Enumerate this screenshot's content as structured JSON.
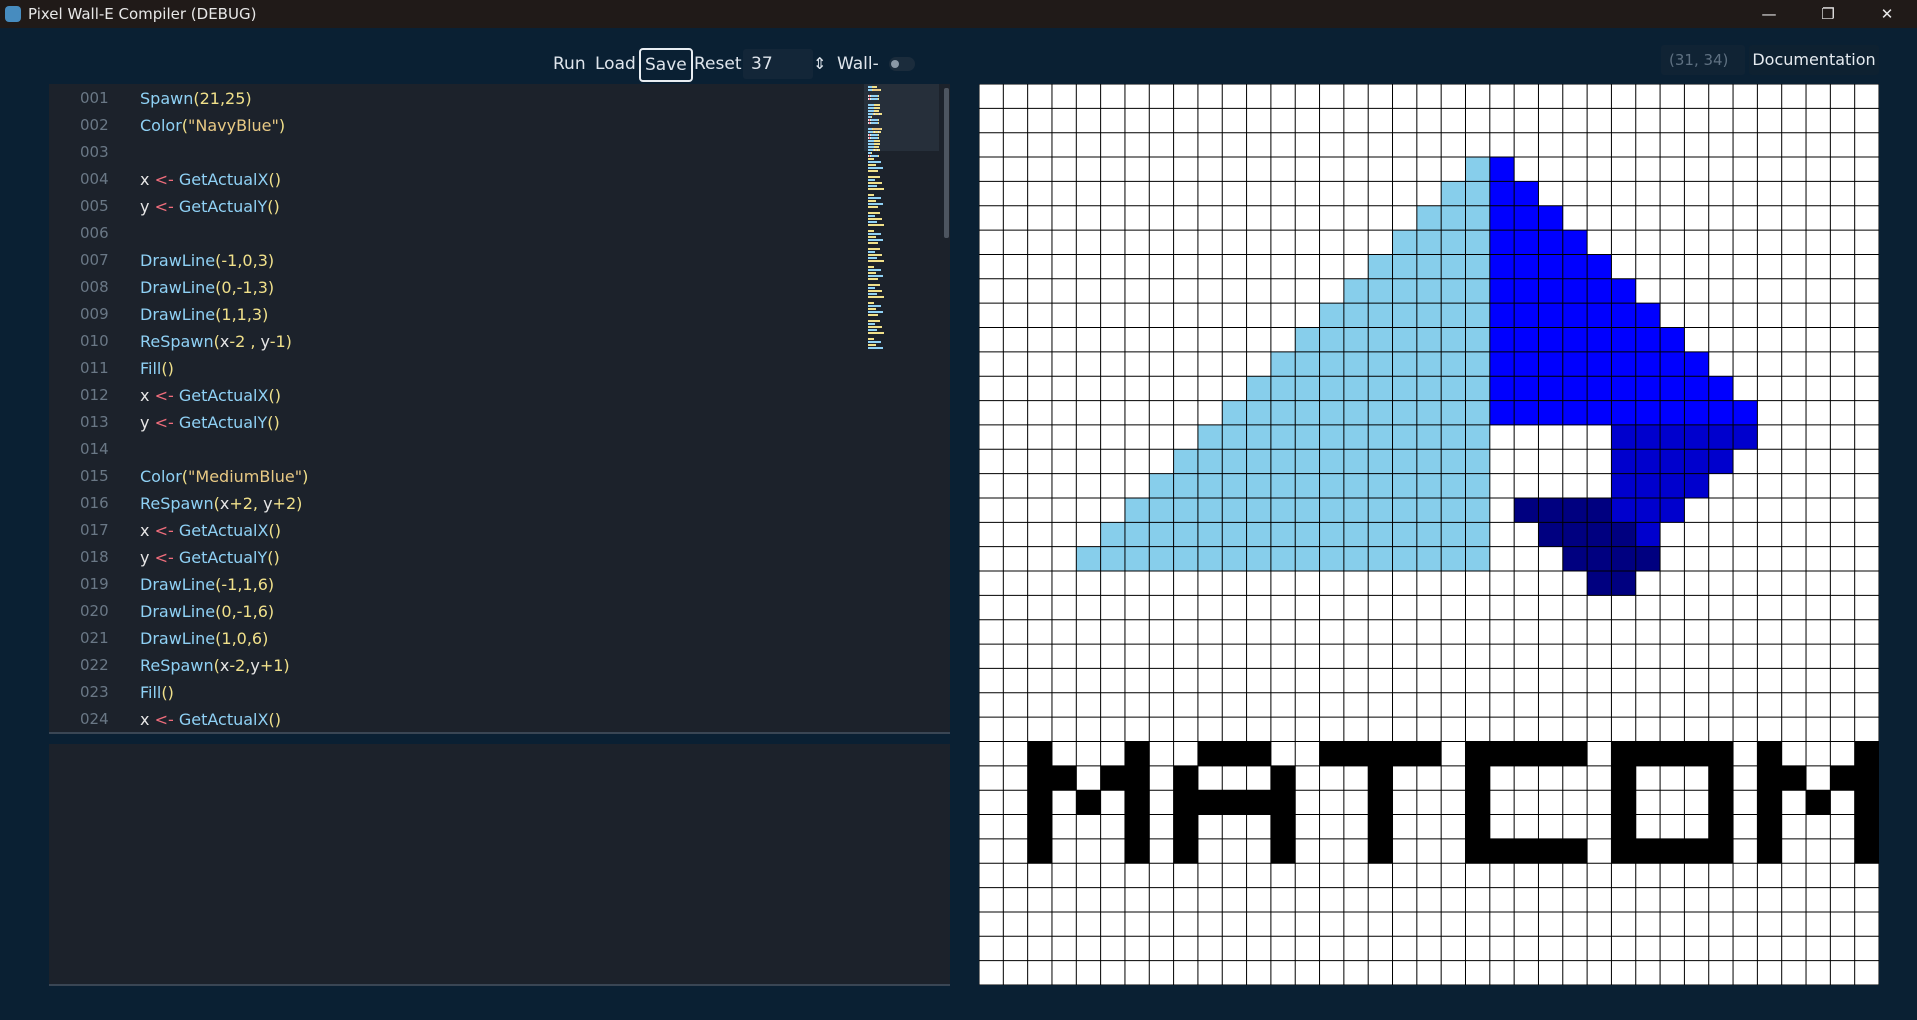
{
  "window": {
    "title": "Pixel Wall-E Compiler (DEBUG)",
    "minimize_glyph": "—",
    "restore_glyph": "❐",
    "close_glyph": "✕"
  },
  "toolbar": {
    "run_label": "Run",
    "load_label": "Load",
    "save_label": "Save",
    "reset_label": "Reset",
    "spin_value": "37",
    "spin_arrows": "⇕",
    "walle_label": "Wall-E",
    "walle_toggle_on": false
  },
  "coordinates_readout": "(31, 34)",
  "documentation_label": "Documentation",
  "editor": {
    "lines": [
      {
        "num": "001",
        "tokens": [
          [
            "f",
            "Spawn"
          ],
          [
            "p",
            "(21,25)"
          ]
        ]
      },
      {
        "num": "002",
        "tokens": [
          [
            "f",
            "Color"
          ],
          [
            "p",
            "("
          ],
          [
            "s",
            "\"NavyBlue\""
          ],
          [
            "p",
            ")"
          ]
        ]
      },
      {
        "num": "003",
        "tokens": []
      },
      {
        "num": "004",
        "tokens": [
          [
            "v",
            "x "
          ],
          [
            "o",
            "<-"
          ],
          [
            "v",
            " "
          ],
          [
            "f",
            "GetActualX"
          ],
          [
            "p",
            "()"
          ]
        ]
      },
      {
        "num": "005",
        "tokens": [
          [
            "v",
            "y "
          ],
          [
            "o",
            "<-"
          ],
          [
            "v",
            " "
          ],
          [
            "f",
            "GetActualY"
          ],
          [
            "p",
            "()"
          ]
        ]
      },
      {
        "num": "006",
        "tokens": []
      },
      {
        "num": "007",
        "tokens": [
          [
            "f",
            "DrawLine"
          ],
          [
            "p",
            "(-1,0,3)"
          ]
        ]
      },
      {
        "num": "008",
        "tokens": [
          [
            "f",
            "DrawLine"
          ],
          [
            "p",
            "(0,-1,3)"
          ]
        ]
      },
      {
        "num": "009",
        "tokens": [
          [
            "f",
            "DrawLine"
          ],
          [
            "p",
            "(1,1,3)"
          ]
        ]
      },
      {
        "num": "010",
        "tokens": [
          [
            "f",
            "ReSpawn"
          ],
          [
            "p",
            "("
          ],
          [
            "v",
            "x"
          ],
          [
            "p",
            "-2 , "
          ],
          [
            "v",
            "y"
          ],
          [
            "p",
            "-1)"
          ]
        ]
      },
      {
        "num": "011",
        "tokens": [
          [
            "f",
            "Fill"
          ],
          [
            "p",
            "()"
          ]
        ]
      },
      {
        "num": "012",
        "tokens": [
          [
            "v",
            "x "
          ],
          [
            "o",
            "<-"
          ],
          [
            "v",
            " "
          ],
          [
            "f",
            "GetActualX"
          ],
          [
            "p",
            "()"
          ]
        ]
      },
      {
        "num": "013",
        "tokens": [
          [
            "v",
            "y "
          ],
          [
            "o",
            "<-"
          ],
          [
            "v",
            " "
          ],
          [
            "f",
            "GetActualY"
          ],
          [
            "p",
            "()"
          ]
        ]
      },
      {
        "num": "014",
        "tokens": []
      },
      {
        "num": "015",
        "tokens": [
          [
            "f",
            "Color"
          ],
          [
            "p",
            "("
          ],
          [
            "s",
            "\"MediumBlue\""
          ],
          [
            "p",
            ")"
          ]
        ]
      },
      {
        "num": "016",
        "tokens": [
          [
            "f",
            "ReSpawn"
          ],
          [
            "p",
            "("
          ],
          [
            "v",
            "x"
          ],
          [
            "p",
            "+2, "
          ],
          [
            "v",
            "y"
          ],
          [
            "p",
            "+2)"
          ]
        ]
      },
      {
        "num": "017",
        "tokens": [
          [
            "v",
            "x "
          ],
          [
            "o",
            "<-"
          ],
          [
            "v",
            " "
          ],
          [
            "f",
            "GetActualX"
          ],
          [
            "p",
            "()"
          ]
        ]
      },
      {
        "num": "018",
        "tokens": [
          [
            "v",
            "y "
          ],
          [
            "o",
            "<-"
          ],
          [
            "v",
            " "
          ],
          [
            "f",
            "GetActualY"
          ],
          [
            "p",
            "()"
          ]
        ]
      },
      {
        "num": "019",
        "tokens": [
          [
            "f",
            "DrawLine"
          ],
          [
            "p",
            "(-1,1,6)"
          ]
        ]
      },
      {
        "num": "020",
        "tokens": [
          [
            "f",
            "DrawLine"
          ],
          [
            "p",
            "(0,-1,6)"
          ]
        ]
      },
      {
        "num": "021",
        "tokens": [
          [
            "f",
            "DrawLine"
          ],
          [
            "p",
            "(1,0,6)"
          ]
        ]
      },
      {
        "num": "022",
        "tokens": [
          [
            "f",
            "ReSpawn"
          ],
          [
            "p",
            "("
          ],
          [
            "v",
            "x"
          ],
          [
            "p",
            "-2,"
          ],
          [
            "v",
            "y"
          ],
          [
            "p",
            "+1)"
          ]
        ]
      },
      {
        "num": "023",
        "tokens": [
          [
            "f",
            "Fill"
          ],
          [
            "p",
            "()"
          ]
        ]
      },
      {
        "num": "024",
        "tokens": [
          [
            "v",
            "x "
          ],
          [
            "o",
            "<-"
          ],
          [
            "v",
            " "
          ],
          [
            "f",
            "GetActualX"
          ],
          [
            "p",
            "()"
          ]
        ]
      }
    ]
  },
  "canvas": {
    "grid_size": 37,
    "palette": {
      "L": "#87ceeb",
      "B": "#0000ff",
      "M": "#0000cd",
      "N": "#000080",
      "K": "#000000"
    },
    "rows": [
      ".....................................",
      ".....................................",
      ".....................................",
      "....................LB...............",
      "...................LLBB..............",
      "..................LLLBBB.............",
      ".................LLLLBBBB............",
      "................LLLLLBBBBB...........",
      "...............LLLLLLBBBBBB..........",
      "..............LLLLLLLBBBBBBB.........",
      ".............LLLLLLLLBBBBBBBB........",
      "............LLLLLLLLLBBBBBBBBB.......",
      "...........LLLLLLLLLLBBBBBBBBBB......",
      "..........LLLLLLLLLLLBBBBBBBBBBB.....",
      ".........LLLLLLLLLLLL.....MMMMMM.....",
      "........LLLLLLLLLLLLL.....MMMMM......",
      ".......LLLLLLLLLLLLLL.....MMMM.......",
      "......LLLLLLLLLLLLLLL.NNNNMMM........",
      ".....LLLLLLLLLLLLLLLL..NNNNM.........",
      "....LLLLLLLLLLLLLLLLL...NNNN.........",
      ".........................NN..........",
      ".....................................",
      ".....................................",
      ".....................................",
      ".....................................",
      ".....................................",
      ".....................................",
      "..KKKKKKKKKKKKKKKKKKKKKKKKKKKKKKKKK..",
      "..KKKKKKKKKKKKKKKKKKKKKKKKKKKKKKKKK..",
      "..KKKKKKKKKKKKKKKKKKKKKKKKKKKKKKKKK..",
      "..KKKKKKKKKKKKKKKKKKKKKKKKKKKKKKKKK..",
      "..KKKKKKKKKKKKKKKKKKKKKKKKKKKKKKKKK..",
      ".....................................",
      ".....................................",
      ".....................................",
      ".....................................",
      "....................................."
    ],
    "matcom_rows": [
      "..K..KKKKKKK.KKKKKKK.KKKKKKK.KKKKKK.",
      "..KK.K.K..K..K.....K.K.....K.K..KK..",
      "..K.K..K..K..KKKKKKK.K.....K.K.K.K..",
      "..K....K..K..K.....K.K.....K.K...K..",
      "..K....KKKKK.K.....K.KKKKKKK.K...K.."
    ]
  }
}
